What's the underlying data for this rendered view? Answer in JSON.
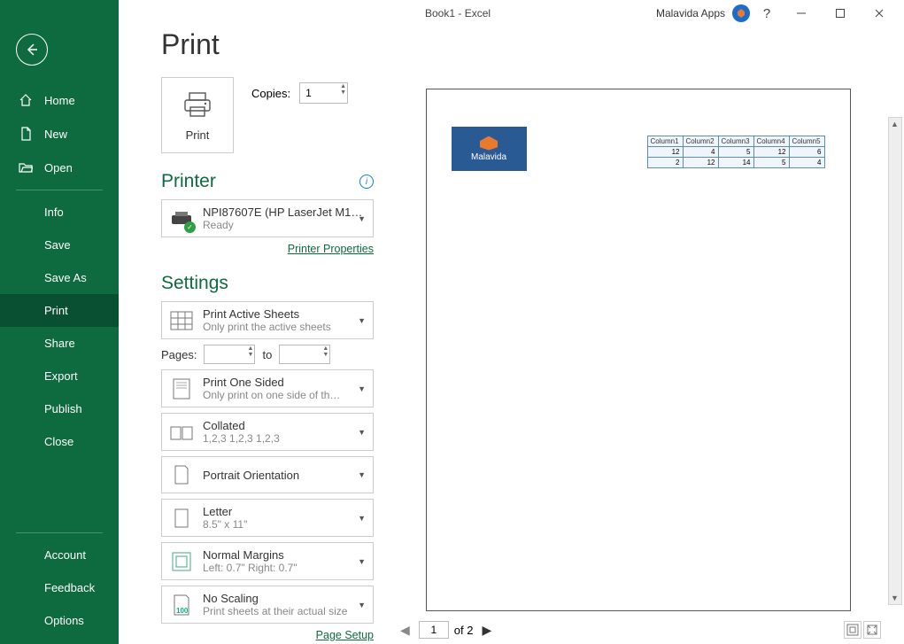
{
  "titlebar": {
    "title": "Book1  -  Excel",
    "apps": "Malavida Apps",
    "help": "?"
  },
  "sidebar": {
    "top": [
      {
        "label": "Home",
        "icon": "home"
      },
      {
        "label": "New",
        "icon": "doc"
      },
      {
        "label": "Open",
        "icon": "folder"
      }
    ],
    "mid": [
      "Info",
      "Save",
      "Save As",
      "Print",
      "Share",
      "Export",
      "Publish",
      "Close"
    ],
    "bottom": [
      "Account",
      "Feedback",
      "Options"
    ]
  },
  "page_title": "Print",
  "print_button": "Print",
  "copies": {
    "label": "Copies:",
    "value": "1"
  },
  "printer_heading": "Printer",
  "printer": {
    "name": "NPI87607E (HP LaserJet M15…",
    "status": "Ready"
  },
  "printer_props": "Printer Properties",
  "settings_heading": "Settings",
  "settings": {
    "sheets": {
      "title": "Print Active Sheets",
      "sub": "Only print the active sheets"
    },
    "pages_label": "Pages:",
    "pages_to": "to",
    "sides": {
      "title": "Print One Sided",
      "sub": "Only print on one side of th…"
    },
    "collate": {
      "title": "Collated",
      "sub": "1,2,3     1,2,3     1,2,3"
    },
    "orient": {
      "title": "Portrait Orientation",
      "sub": ""
    },
    "size": {
      "title": "Letter",
      "sub": "8.5\" x 11\""
    },
    "margins": {
      "title": "Normal Margins",
      "sub": "Left:  0.7\"    Right:  0.7\""
    },
    "scale": {
      "title": "No Scaling",
      "sub": "Print sheets at their actual size"
    }
  },
  "page_setup": "Page Setup",
  "preview": {
    "logo_text": "Malavida",
    "headers": [
      "Column1",
      "Column2",
      "Column3",
      "Column4",
      "Column5"
    ],
    "rows": [
      [
        "12",
        "4",
        "5",
        "12",
        "6"
      ],
      [
        "2",
        "12",
        "14",
        "5",
        "4"
      ]
    ],
    "page_current": "1",
    "page_total": "of 2"
  }
}
